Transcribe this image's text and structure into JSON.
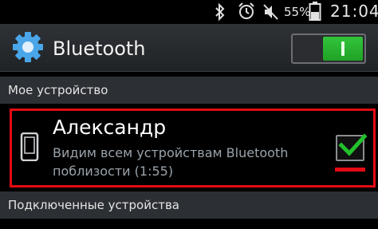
{
  "status_bar": {
    "battery_percent": "55%",
    "time": "21:04",
    "icons": [
      "bluetooth-icon",
      "alarm-icon",
      "mute-icon",
      "battery-icon"
    ]
  },
  "action_bar": {
    "title": "Bluetooth",
    "toggle_state": "on",
    "icon": "gear-icon"
  },
  "sections": {
    "my_device": "Мое устройство",
    "connected": "Подключенные устройства"
  },
  "device": {
    "name": "Александр",
    "status_line1": "Видим всем устройствам Bluetooth",
    "status_line2": "поблизости (1:55)",
    "visible_checked": true,
    "icon": "phone-icon"
  },
  "colors": {
    "toggle_on": "#22a82a",
    "highlight": "#e30a14",
    "check": "#22c12c"
  }
}
